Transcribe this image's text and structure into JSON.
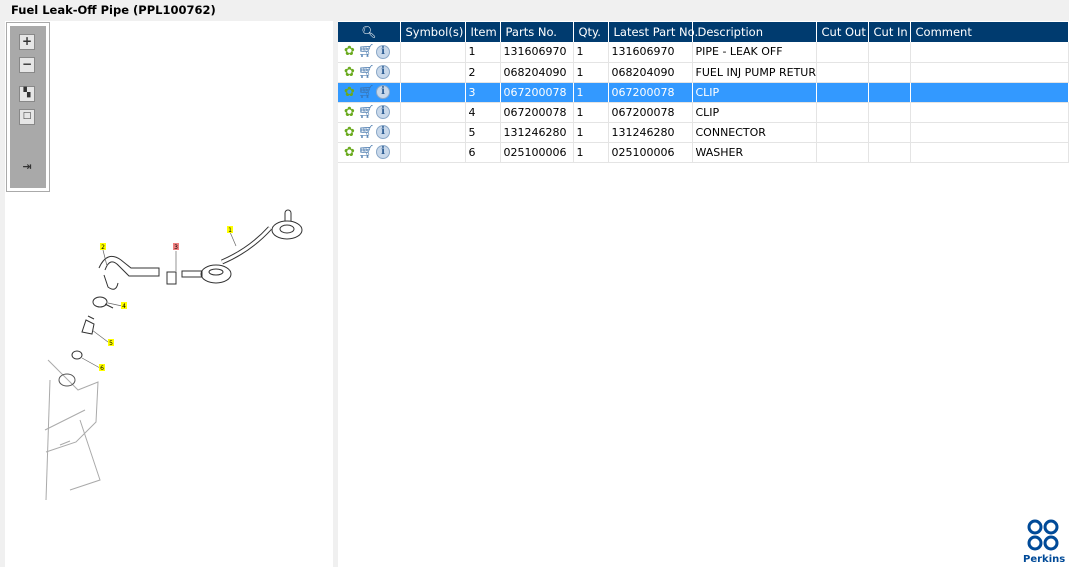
{
  "title": "Fuel Leak-Off Pipe (PPL100762)",
  "toolbar": {
    "zoom_in": "+",
    "zoom_out": "−"
  },
  "diagram": {
    "callouts": [
      "1",
      "2",
      "3",
      "4",
      "5",
      "6"
    ],
    "highlighted": "3"
  },
  "table": {
    "columns": [
      "",
      "Symbol(s)",
      "Item",
      "Parts No.",
      "Qty.",
      "Latest Part No.",
      "Description",
      "Cut Out",
      "Cut In",
      "Comment"
    ],
    "rows": [
      {
        "item": "1",
        "parts_no": "131606970",
        "qty": "1",
        "latest": "131606970",
        "desc": "PIPE - LEAK OFF"
      },
      {
        "item": "2",
        "parts_no": "068204090",
        "qty": "1",
        "latest": "068204090",
        "desc": "FUEL INJ PUMP RETURN"
      },
      {
        "item": "3",
        "parts_no": "067200078",
        "qty": "1",
        "latest": "067200078",
        "desc": "CLIP",
        "selected": true
      },
      {
        "item": "4",
        "parts_no": "067200078",
        "qty": "1",
        "latest": "067200078",
        "desc": "CLIP"
      },
      {
        "item": "5",
        "parts_no": "131246280",
        "qty": "1",
        "latest": "131246280",
        "desc": "CONNECTOR"
      },
      {
        "item": "6",
        "parts_no": "025100006",
        "qty": "1",
        "latest": "025100006",
        "desc": "WASHER"
      }
    ]
  },
  "logo": {
    "text": "Perkins"
  },
  "colors": {
    "header": "#003b6f",
    "selected": "#3399ff",
    "callout": "#ffff00",
    "callout_selected": "#f08080"
  }
}
